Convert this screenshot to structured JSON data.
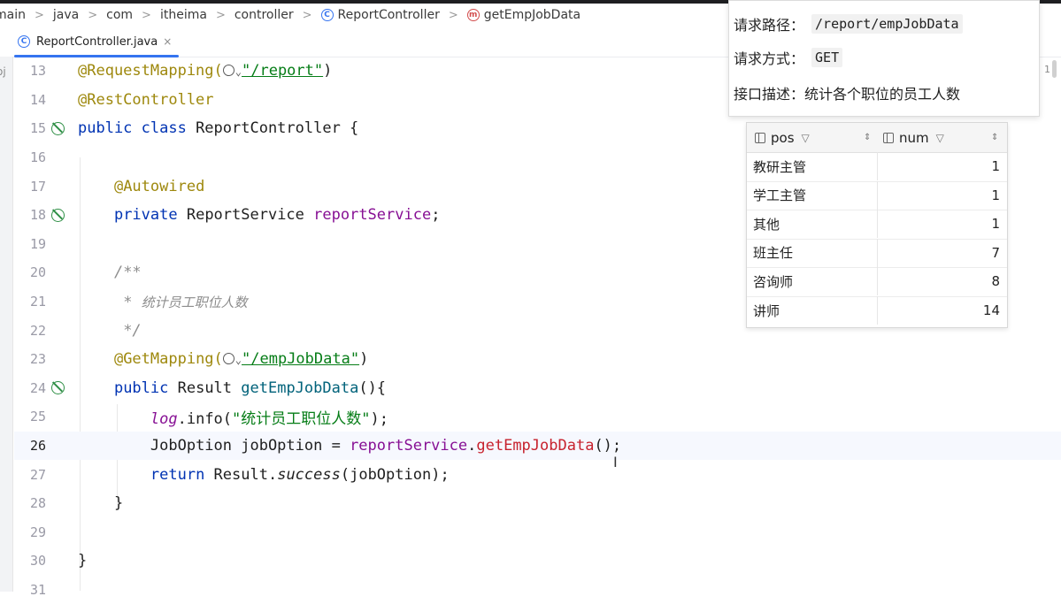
{
  "breadcrumb": [
    "main",
    "java",
    "com",
    "itheima",
    "controller",
    "ReportController",
    "getEmpJobData"
  ],
  "tab": {
    "label": "ReportController.java",
    "close": "×",
    "class_icon": "C"
  },
  "method_icon": "m",
  "left_strip_label": "oj",
  "right_edge_text": "1",
  "code_lines": [
    {
      "n": "13",
      "current": false
    },
    {
      "n": "14",
      "current": false
    },
    {
      "n": "15",
      "current": false
    },
    {
      "n": "16",
      "current": false
    },
    {
      "n": "17",
      "current": false
    },
    {
      "n": "18",
      "current": false
    },
    {
      "n": "19",
      "current": false
    },
    {
      "n": "20",
      "current": false
    },
    {
      "n": "21",
      "current": false
    },
    {
      "n": "22",
      "current": false
    },
    {
      "n": "23",
      "current": false
    },
    {
      "n": "24",
      "current": false
    },
    {
      "n": "25",
      "current": false
    },
    {
      "n": "26",
      "current": true
    },
    {
      "n": "27",
      "current": false
    },
    {
      "n": "28",
      "current": false
    },
    {
      "n": "29",
      "current": false
    },
    {
      "n": "30",
      "current": false
    },
    {
      "n": "31",
      "current": false
    }
  ],
  "code": {
    "l13_ann": "@RequestMapping(",
    "l13_path": "\"/report\"",
    "l13_close": ")",
    "l14": "@RestController",
    "l15_kw": "public class ",
    "l15_rest": "ReportController {",
    "l17": "@Autowired",
    "l18_kw": "private ",
    "l18_type": "ReportService ",
    "l18_field": "reportService",
    "l18_end": ";",
    "l20": "/**",
    "l21_star": " * ",
    "l21_text": "统计员工职位人数",
    "l22": " */",
    "l23_ann": "@GetMapping(",
    "l23_path": "\"/empJobData\"",
    "l23_close": ")",
    "l24_kw": "public ",
    "l24_type": "Result ",
    "l24_meth": "getEmpJobData",
    "l24_end": "(){",
    "l25_log": "log",
    "l25_mid": ".info(",
    "l25_str": "\"统计员工职位人数\"",
    "l25_end": ");",
    "l26_type": "JobOption jobOption = ",
    "l26_field": "reportService",
    "l26_dot": ".",
    "l26_call": "getEmpJobData",
    "l26_end": "();",
    "l27_kw": "return ",
    "l27_cls": "Result.",
    "l27_meth": "success",
    "l27_end": "(jobOption);",
    "l28": "}",
    "l30": "}"
  },
  "info": {
    "path_label": "请求路径：",
    "path_value": "/report/empJobData",
    "method_label": "请求方式：",
    "method_value": "GET",
    "desc_label": "接口描述：",
    "desc_value": "统计各个职位的员工人数"
  },
  "result_table": {
    "columns": [
      "pos",
      "num"
    ],
    "rows": [
      {
        "pos": "教研主管",
        "num": "1"
      },
      {
        "pos": "学工主管",
        "num": "1"
      },
      {
        "pos": "其他",
        "num": "1"
      },
      {
        "pos": "班主任",
        "num": "7"
      },
      {
        "pos": "咨询师",
        "num": "8"
      },
      {
        "pos": "讲师",
        "num": "14"
      }
    ]
  },
  "icons": {
    "globe": "globe-icon",
    "filter": "filter-icon",
    "sort": "sort-icon",
    "column": "column-icon"
  }
}
